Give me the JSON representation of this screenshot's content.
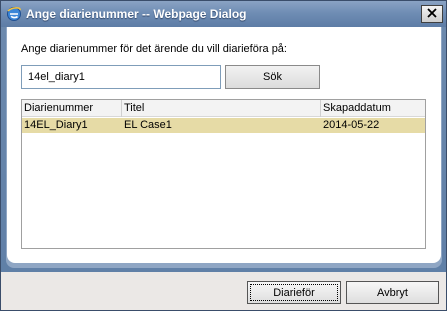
{
  "window": {
    "title": "Ange diarienummer -- Webpage Dialog",
    "icon": "ie-icon",
    "close_label": "✕"
  },
  "form": {
    "prompt": "Ange diarienummer för det ärende du vill diarieföra på:",
    "search_value": "14el_diary1",
    "search_button": "Sök"
  },
  "results": {
    "columns": [
      "Diarienummer",
      "Titel",
      "Skapaddatum"
    ],
    "rows": [
      [
        "14EL_Diary1",
        "EL Case1",
        "2014-05-22"
      ]
    ],
    "selected_row_color": "#e6dba6"
  },
  "footer": {
    "primary_button": "Diarieför",
    "cancel_button": "Avbryt"
  }
}
